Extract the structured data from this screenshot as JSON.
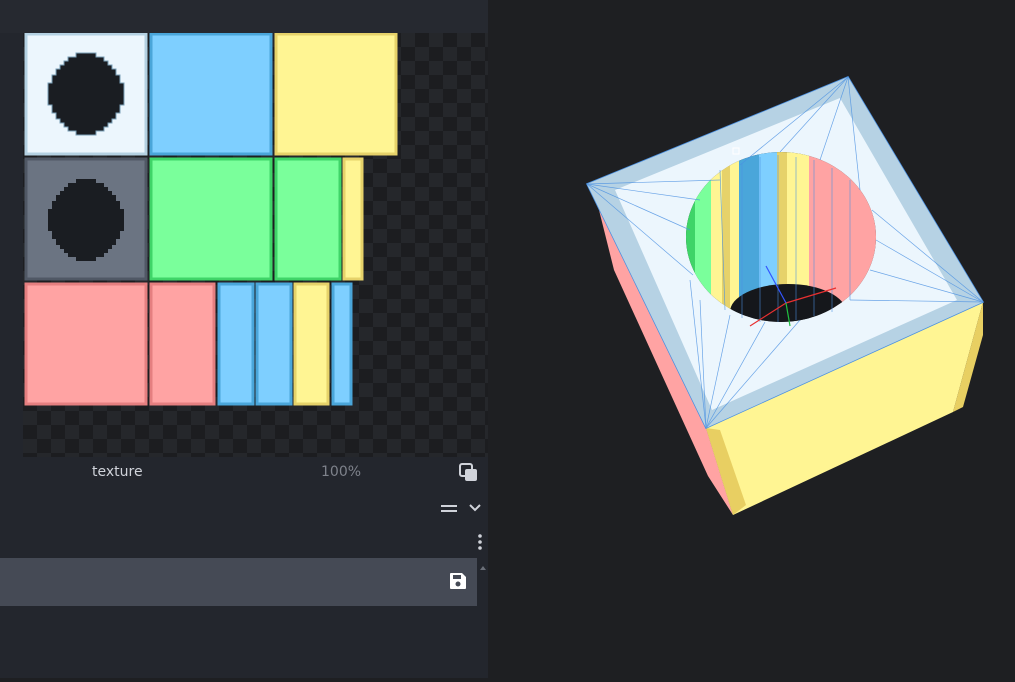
{
  "uv_panel": {
    "texture_name": "texture",
    "zoom": "100%",
    "face_colors": {
      "white": "#ecf6fd",
      "blue": "#7ecfff",
      "yellow": "#fff593",
      "green": "#7aff9b",
      "red": "#ffa3a3",
      "gray": "#6b7482",
      "hole": "#1a1d22"
    }
  },
  "toolbar": {
    "menu_icon": "menu-icon",
    "collapse_icon": "chevron-down-icon",
    "more_icon": "kebab-menu-icon"
  },
  "texture_row": {
    "save_icon": "save-icon"
  },
  "viewport": {
    "background": "#1e1f22",
    "object": "cube-with-cylindrical-hole",
    "axis_colors": {
      "x": "#e83030",
      "y": "#20c040",
      "z": "#3355ff"
    }
  }
}
